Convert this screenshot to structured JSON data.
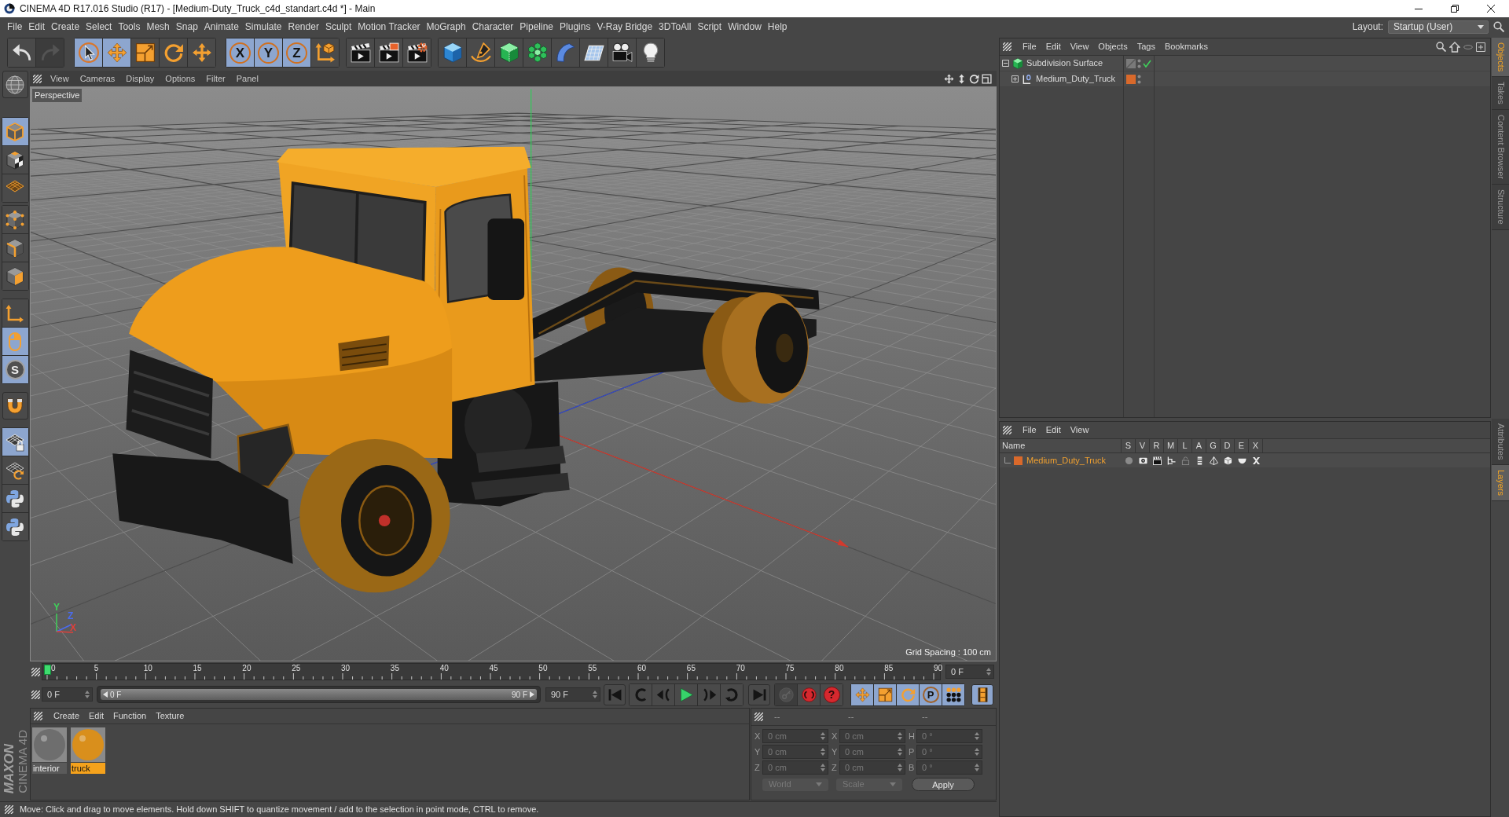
{
  "window": {
    "title": "CINEMA 4D R17.016 Studio (R17) - [Medium-Duty_Truck_c4d_standart.c4d *] - Main"
  },
  "menu_bar": {
    "items": [
      "File",
      "Edit",
      "Create",
      "Select",
      "Tools",
      "Mesh",
      "Snap",
      "Animate",
      "Simulate",
      "Render",
      "Sculpt",
      "Motion Tracker",
      "MoGraph",
      "Character",
      "Pipeline",
      "Plugins",
      "V-Ray Bridge",
      "3DToAll",
      "Script",
      "Window",
      "Help"
    ],
    "layout_label": "Layout:",
    "layout_value": "Startup (User)"
  },
  "toolbar": {
    "groups": [
      [
        {
          "kind": "undo",
          "active": false,
          "disabled": false
        },
        {
          "kind": "redo",
          "active": false,
          "disabled": true
        }
      ],
      [
        {
          "kind": "select",
          "active": true,
          "disabled": false
        },
        {
          "kind": "move",
          "active": true,
          "disabled": false
        },
        {
          "kind": "scale",
          "active": false,
          "disabled": false
        },
        {
          "kind": "rotate",
          "active": false,
          "disabled": false
        },
        {
          "kind": "recent",
          "active": false,
          "disabled": false
        }
      ],
      [
        {
          "kind": "axis",
          "label": "X",
          "active": true,
          "disabled": false
        },
        {
          "kind": "axis",
          "label": "Y",
          "active": true,
          "disabled": false
        },
        {
          "kind": "axis",
          "label": "Z",
          "active": true,
          "disabled": false
        },
        {
          "kind": "coords",
          "active": false,
          "disabled": false
        }
      ],
      [
        {
          "kind": "renderview",
          "active": false,
          "disabled": false
        },
        {
          "kind": "renderpicture",
          "active": false,
          "disabled": false
        },
        {
          "kind": "rendersettings",
          "active": false,
          "disabled": false
        }
      ],
      [
        {
          "kind": "cube",
          "active": false,
          "disabled": false
        },
        {
          "kind": "pen",
          "active": false,
          "disabled": false
        },
        {
          "kind": "subdivision",
          "active": false,
          "disabled": false
        },
        {
          "kind": "cloner",
          "active": false,
          "disabled": false
        },
        {
          "kind": "deformer",
          "active": false,
          "disabled": false
        },
        {
          "kind": "floor",
          "active": false,
          "disabled": false
        },
        {
          "kind": "camera",
          "active": false,
          "disabled": false
        },
        {
          "kind": "light",
          "active": false,
          "disabled": false
        }
      ]
    ]
  },
  "left_toolbar": {
    "groups": [
      [
        {
          "kind": "globe",
          "active": false
        }
      ],
      [
        {
          "kind": "model",
          "active": true
        },
        {
          "kind": "texture",
          "active": false
        },
        {
          "kind": "workgrid",
          "active": false
        }
      ],
      [
        {
          "kind": "points",
          "active": false
        },
        {
          "kind": "edges",
          "active": false
        },
        {
          "kind": "polygons",
          "active": false
        }
      ],
      [
        {
          "kind": "axismode",
          "active": false
        },
        {
          "kind": "tweak",
          "active": true
        },
        {
          "kind": "solo",
          "label": "S",
          "active": true
        }
      ],
      [
        {
          "kind": "magnet",
          "active": false
        }
      ],
      [
        {
          "kind": "lockgrid",
          "active": true
        },
        {
          "kind": "gridrotate",
          "active": false
        },
        {
          "kind": "python",
          "active": false
        },
        {
          "kind": "python",
          "active": false
        }
      ]
    ]
  },
  "viewport": {
    "menu": [
      "View",
      "Cameras",
      "Display",
      "Options",
      "Filter",
      "Panel"
    ],
    "camera": "Perspective",
    "grid_spacing": "Grid Spacing : 100 cm",
    "gizmo_labels": [
      {
        "text": "Y",
        "color": "#3fd15a"
      },
      {
        "text": "Z",
        "color": "#4a6cf0"
      },
      {
        "text": "X",
        "color": "#e0403a"
      }
    ]
  },
  "timeline": {
    "ticks": [
      "0",
      "5",
      "10",
      "15",
      "20",
      "25",
      "30",
      "35",
      "40",
      "45",
      "50",
      "55",
      "60",
      "65",
      "70",
      "75",
      "80",
      "85",
      "90"
    ],
    "level": 0,
    "frame_field": "0 F"
  },
  "playback": {
    "start_field": "0 F",
    "range": {
      "start": "0 F",
      "end": "90 F",
      "level": 1
    },
    "end_field": "90 F",
    "groups": [
      [
        {
          "kind": "start",
          "active": false,
          "disabled": false
        }
      ],
      [
        {
          "kind": "prevkey",
          "active": false,
          "disabled": false
        },
        {
          "kind": "stepback",
          "active": false,
          "disabled": false
        },
        {
          "kind": "play",
          "active": false,
          "disabled": false
        },
        {
          "kind": "stepforward",
          "active": false,
          "disabled": false
        },
        {
          "kind": "nextkey",
          "active": false,
          "disabled": false
        }
      ],
      [
        {
          "kind": "end",
          "active": false,
          "disabled": false
        }
      ],
      [
        {
          "kind": "key",
          "active": false,
          "disabled": true
        },
        {
          "kind": "record",
          "active": false,
          "disabled": false
        },
        {
          "kind": "autokey",
          "label": "?",
          "active": false,
          "disabled": false
        }
      ],
      [
        {
          "kind": "movekey",
          "active": true,
          "disabled": false
        },
        {
          "kind": "scalekey",
          "active": true,
          "disabled": false
        },
        {
          "kind": "rotatekey",
          "active": true,
          "disabled": false
        },
        {
          "kind": "param",
          "label": "P",
          "active": true,
          "disabled": false
        },
        {
          "kind": "pla",
          "active": true,
          "disabled": false
        }
      ],
      [
        {
          "kind": "timeline",
          "active": true,
          "disabled": false
        }
      ]
    ]
  },
  "material_manager": {
    "menu": [
      "Create",
      "Edit",
      "Function",
      "Texture"
    ],
    "materials": [
      {
        "name": "interior",
        "color": "#6e6e6e",
        "selected": false
      },
      {
        "name": "truck",
        "color": "#d98f1c",
        "selected": true
      }
    ]
  },
  "coordinates": {
    "headers": [
      "--",
      "--",
      "--"
    ],
    "disabled": true,
    "rows": [
      [
        {
          "label": "X",
          "value": "0 cm"
        },
        {
          "label": "X",
          "value": "0 cm"
        },
        {
          "label": "H",
          "value": "0 °"
        }
      ],
      [
        {
          "label": "Y",
          "value": "0 cm"
        },
        {
          "label": "Y",
          "value": "0 cm"
        },
        {
          "label": "P",
          "value": "0 °"
        }
      ],
      [
        {
          "label": "Z",
          "value": "0 cm"
        },
        {
          "label": "Z",
          "value": "0 cm"
        },
        {
          "label": "B",
          "value": "0 °"
        }
      ]
    ],
    "dropdowns": [
      "World",
      "Scale"
    ],
    "apply": "Apply"
  },
  "logo": {
    "lines": [
      "MAXON",
      "CINEMA 4D"
    ]
  },
  "status_bar": {
    "text": "Move: Click and drag to move elements. Hold down SHIFT to quantize movement / add to the selection in point mode, CTRL to remove."
  },
  "object_manager": {
    "menu": [
      "File",
      "Edit",
      "View",
      "Objects",
      "Tags",
      "Bookmarks"
    ],
    "objects": [
      {
        "kind": "subdivision",
        "name": "Subdivision Surface",
        "expanded": true,
        "enabled": true,
        "children": [
          {
            "kind": "null",
            "name": "Medium_Duty_Truck",
            "expanded": false,
            "color": "#d9692b"
          }
        ]
      }
    ]
  },
  "layer_manager": {
    "menu": [
      "File",
      "Edit",
      "View"
    ],
    "columns": [
      "Name",
      "S",
      "V",
      "R",
      "M",
      "L",
      "A",
      "G",
      "D",
      "E",
      "X"
    ],
    "layers": [
      {
        "name": "Medium_Duty_Truck",
        "color": "#d9692b",
        "flags": [
          {
            "kind": "solo",
            "on": false
          },
          {
            "kind": "view",
            "on": true
          },
          {
            "kind": "render",
            "on": true
          },
          {
            "kind": "manager",
            "on": true
          },
          {
            "kind": "locked",
            "on": false
          },
          {
            "kind": "animation",
            "on": true
          },
          {
            "kind": "generators",
            "on": true
          },
          {
            "kind": "deformers",
            "on": true
          },
          {
            "kind": "expressions",
            "on": true
          },
          {
            "kind": "xrefs",
            "on": true
          }
        ]
      }
    ]
  },
  "side_tabs": {
    "top": [
      {
        "label": "Objects",
        "selected": true
      },
      {
        "label": "Takes",
        "selected": false
      },
      {
        "label": "Content Browser",
        "selected": false
      },
      {
        "label": "Structure",
        "selected": false
      }
    ],
    "bottom": [
      {
        "label": "Attributes",
        "selected": false
      },
      {
        "label": "Layers",
        "selected": true
      }
    ]
  }
}
